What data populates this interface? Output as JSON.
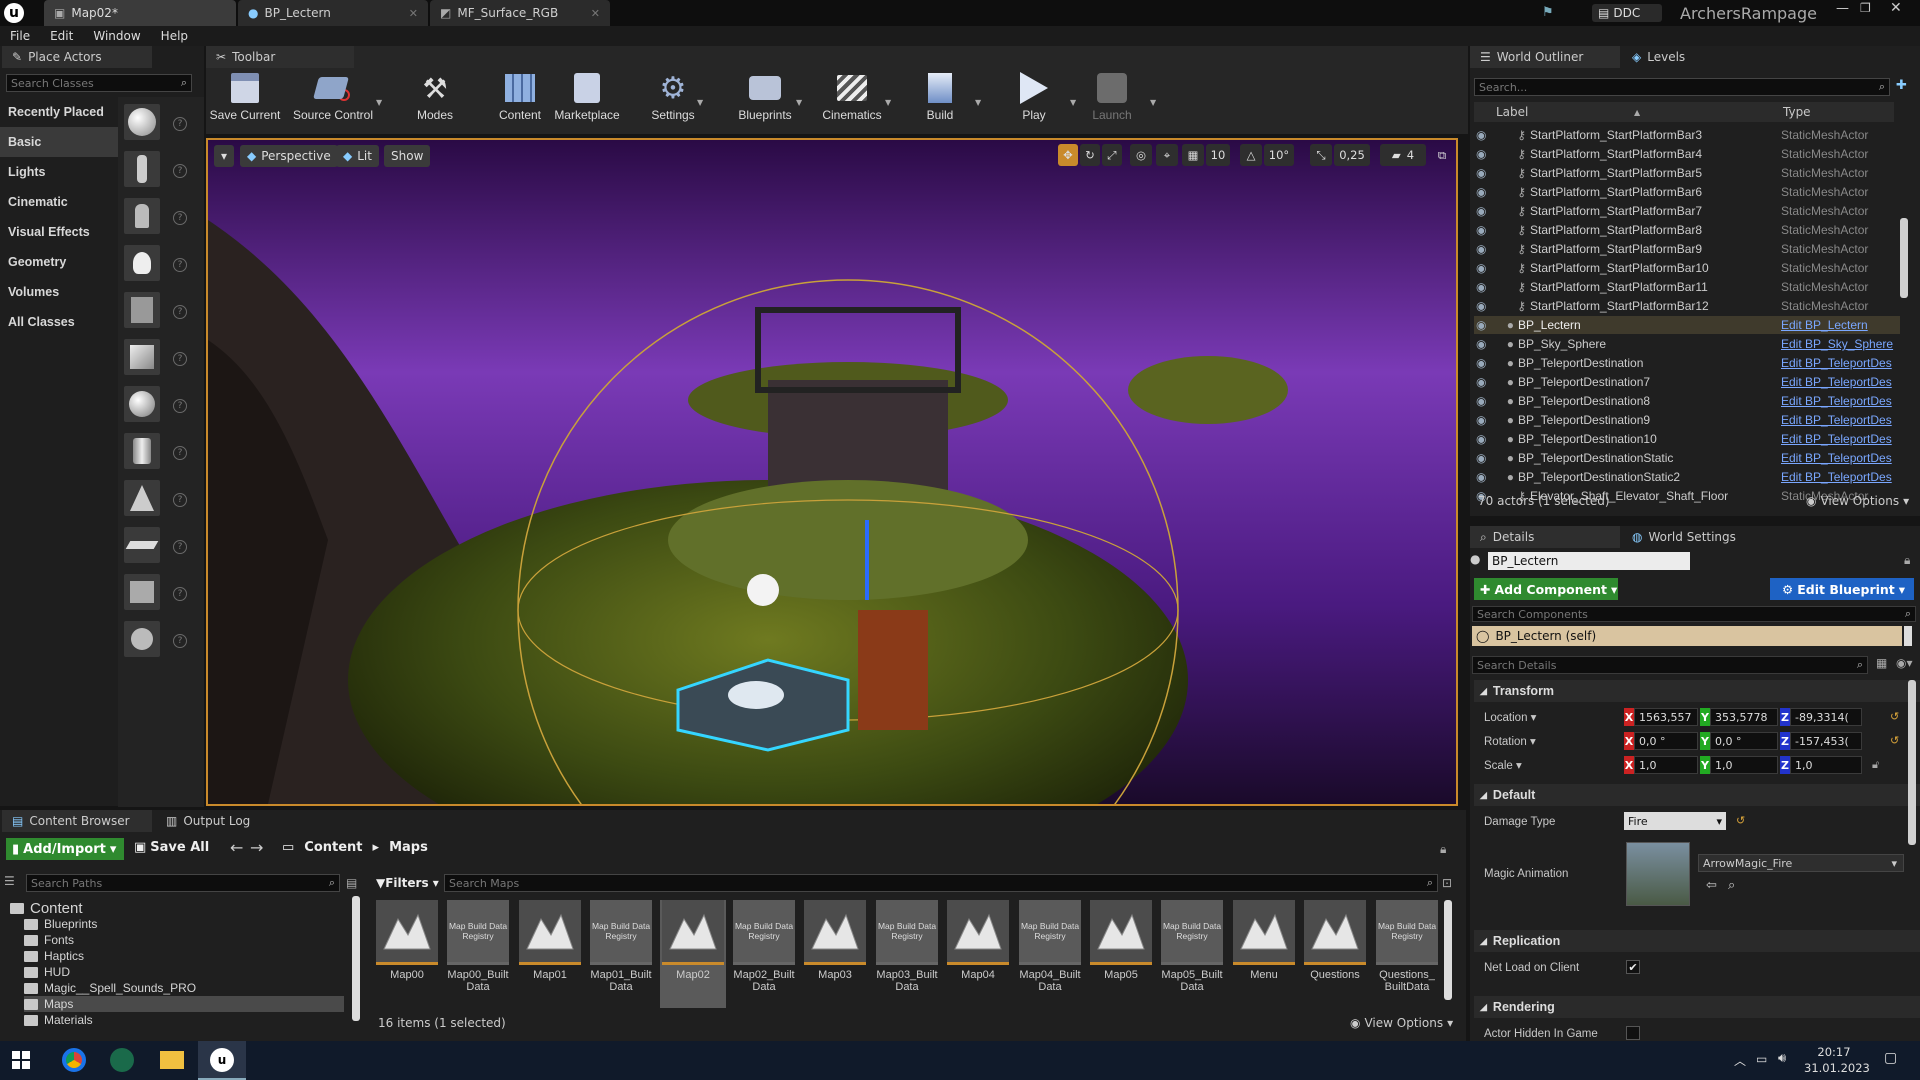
{
  "doc_tabs": [
    {
      "label": "Map02*"
    },
    {
      "label": "BP_Lectern"
    },
    {
      "label": "MF_Surface_RGB"
    }
  ],
  "title_right": {
    "ddc": "DDC",
    "project": "ArchersRampage"
  },
  "menu": [
    "File",
    "Edit",
    "Window",
    "Help"
  ],
  "place_actors": {
    "tab": "Place Actors",
    "search_placeholder": "Search Classes",
    "categories": [
      "Recently Placed",
      "Basic",
      "Lights",
      "Cinematic",
      "Visual Effects",
      "Geometry",
      "Volumes",
      "All Classes"
    ]
  },
  "toolbar": {
    "tab": "Toolbar",
    "buttons": [
      "Save Current",
      "Source Control",
      "Modes",
      "Content",
      "Marketplace",
      "Settings",
      "Blueprints",
      "Cinematics",
      "Build",
      "Play",
      "Launch"
    ]
  },
  "viewport": {
    "perspective": "Perspective",
    "lit": "Lit",
    "show": "Show",
    "grid_snap": "10",
    "rot_snap": "10°",
    "scale_snap": "0,25",
    "cam_speed": "4"
  },
  "outliner": {
    "tab": "World Outliner",
    "tab2": "Levels",
    "search_placeholder": "Search...",
    "col_label": "Label",
    "col_type": "Type",
    "rows": [
      {
        "label": "StartPlatform_StartPlatformBar3",
        "type": "StaticMeshActor",
        "link": false,
        "sel": false
      },
      {
        "label": "StartPlatform_StartPlatformBar4",
        "type": "StaticMeshActor",
        "link": false,
        "sel": false
      },
      {
        "label": "StartPlatform_StartPlatformBar5",
        "type": "StaticMeshActor",
        "link": false,
        "sel": false
      },
      {
        "label": "StartPlatform_StartPlatformBar6",
        "type": "StaticMeshActor",
        "link": false,
        "sel": false
      },
      {
        "label": "StartPlatform_StartPlatformBar7",
        "type": "StaticMeshActor",
        "link": false,
        "sel": false
      },
      {
        "label": "StartPlatform_StartPlatformBar8",
        "type": "StaticMeshActor",
        "link": false,
        "sel": false
      },
      {
        "label": "StartPlatform_StartPlatformBar9",
        "type": "StaticMeshActor",
        "link": false,
        "sel": false
      },
      {
        "label": "StartPlatform_StartPlatformBar10",
        "type": "StaticMeshActor",
        "link": false,
        "sel": false
      },
      {
        "label": "StartPlatform_StartPlatformBar11",
        "type": "StaticMeshActor",
        "link": false,
        "sel": false
      },
      {
        "label": "StartPlatform_StartPlatformBar12",
        "type": "StaticMeshActor",
        "link": false,
        "sel": false
      },
      {
        "label": "BP_Lectern",
        "type": "Edit BP_Lectern",
        "link": true,
        "sel": true
      },
      {
        "label": "BP_Sky_Sphere",
        "type": "Edit BP_Sky_Sphere",
        "link": true,
        "sel": false
      },
      {
        "label": "BP_TeleportDestination",
        "type": "Edit BP_TeleportDes",
        "link": true,
        "sel": false
      },
      {
        "label": "BP_TeleportDestination7",
        "type": "Edit BP_TeleportDes",
        "link": true,
        "sel": false
      },
      {
        "label": "BP_TeleportDestination8",
        "type": "Edit BP_TeleportDes",
        "link": true,
        "sel": false
      },
      {
        "label": "BP_TeleportDestination9",
        "type": "Edit BP_TeleportDes",
        "link": true,
        "sel": false
      },
      {
        "label": "BP_TeleportDestination10",
        "type": "Edit BP_TeleportDes",
        "link": true,
        "sel": false
      },
      {
        "label": "BP_TeleportDestinationStatic",
        "type": "Edit BP_TeleportDes",
        "link": true,
        "sel": false
      },
      {
        "label": "BP_TeleportDestinationStatic2",
        "type": "Edit BP_TeleportDes",
        "link": true,
        "sel": false
      },
      {
        "label": "Elevator_Shaft_Elevator_Shaft_Floor",
        "type": "StaticMeshActor",
        "link": false,
        "sel": false
      }
    ],
    "status": "70 actors (1 selected)",
    "view_options": "View Options"
  },
  "details": {
    "tab": "Details",
    "tab2": "World Settings",
    "name": "BP_Lectern",
    "add_component": "Add Component",
    "edit_blueprint": "Edit Blueprint",
    "search_components": "Search Components",
    "self_component": "BP_Lectern (self)",
    "search_details": "Search Details",
    "transform_section": "Transform",
    "location": {
      "label": "Location",
      "x": "1563,557",
      "y": "353,5778",
      "z": "-89,3314("
    },
    "rotation": {
      "label": "Rotation",
      "x": "0,0 °",
      "y": "0,0 °",
      "z": "-157,453("
    },
    "scale": {
      "label": "Scale",
      "x": "1,0",
      "y": "1,0",
      "z": "1,0"
    },
    "default_section": "Default",
    "damage_type": {
      "label": "Damage Type",
      "value": "Fire"
    },
    "magic_animation": {
      "label": "Magic Animation",
      "value": "ArrowMagic_Fire"
    },
    "replication_section": "Replication",
    "net_load": {
      "label": "Net Load on Client",
      "checked": true
    },
    "rendering_section": "Rendering",
    "hidden": {
      "label": "Actor Hidden In Game",
      "checked": false
    }
  },
  "content_browser": {
    "tab": "Content Browser",
    "tab2": "Output Log",
    "add_import": "Add/Import",
    "save_all": "Save All",
    "path": [
      "Content",
      "Maps"
    ],
    "search_paths": "Search Paths",
    "filters": "Filters",
    "search_maps": "Search Maps",
    "tree": [
      {
        "label": "Content",
        "level": 0
      },
      {
        "label": "Blueprints",
        "level": 1
      },
      {
        "label": "Fonts",
        "level": 1
      },
      {
        "label": "Haptics",
        "level": 1
      },
      {
        "label": "HUD",
        "level": 1
      },
      {
        "label": "Magic__Spell_Sounds_PRO",
        "level": 1
      },
      {
        "label": "Maps",
        "level": 1
      },
      {
        "label": "Materials",
        "level": 1
      }
    ],
    "assets": [
      {
        "name": "Map00",
        "kind": "map"
      },
      {
        "name": "Map00_Built Data",
        "kind": "reg"
      },
      {
        "name": "Map01",
        "kind": "map"
      },
      {
        "name": "Map01_Built Data",
        "kind": "reg"
      },
      {
        "name": "Map02",
        "kind": "map",
        "sel": true
      },
      {
        "name": "Map02_Built Data",
        "kind": "reg"
      },
      {
        "name": "Map03",
        "kind": "map"
      },
      {
        "name": "Map03_Built Data",
        "kind": "reg"
      },
      {
        "name": "Map04",
        "kind": "map"
      },
      {
        "name": "Map04_Built Data",
        "kind": "reg"
      },
      {
        "name": "Map05",
        "kind": "map"
      },
      {
        "name": "Map05_Built Data",
        "kind": "reg"
      },
      {
        "name": "Menu",
        "kind": "map"
      },
      {
        "name": "Questions",
        "kind": "map"
      },
      {
        "name": "Questions_ BuiltData",
        "kind": "reg"
      }
    ],
    "registry_label": "Map Build Data Registry",
    "status": "16 items (1 selected)",
    "view_options": "View Options"
  },
  "taskbar": {
    "time": "20:17",
    "date": "31.01.2023"
  }
}
